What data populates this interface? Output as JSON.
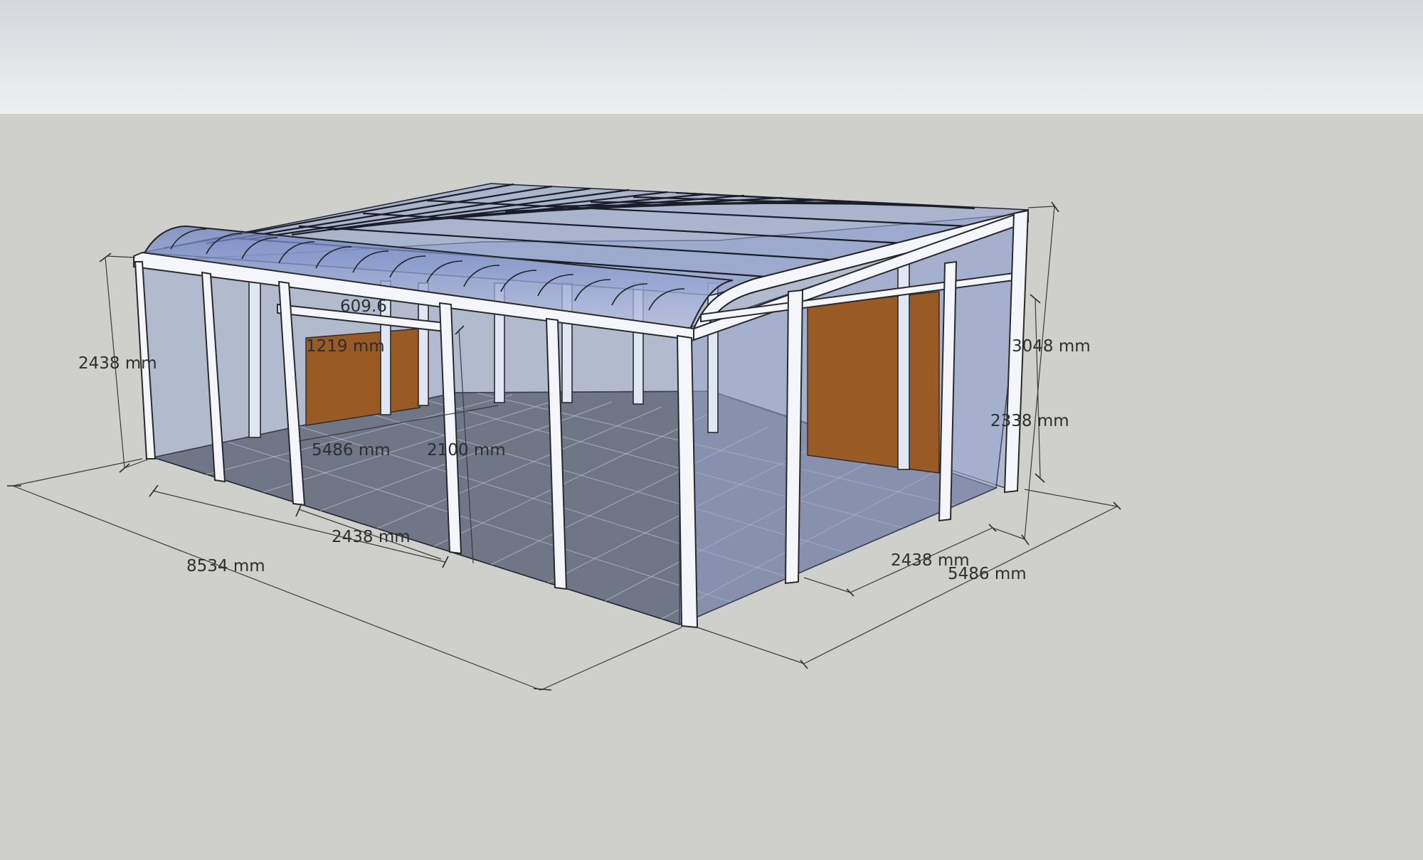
{
  "model": {
    "colors": {
      "sky_top": "#d4d8dd",
      "sky_bottom": "#eef0f1",
      "ground": "#cfd0cb",
      "glass": "#8a9ccf",
      "frame": "#f4f6fb",
      "wood_panel": "#9a5a24",
      "floor": "#6f7786"
    }
  },
  "dimensions": {
    "height_left": "2438 mm",
    "width_front": "8534 mm",
    "bay_front": "2438 mm",
    "inner_depth": "5486 mm",
    "door_height": "2100 mm",
    "transom_height": "1219 mm",
    "transom_width": "609.6",
    "height_total": "3048 mm",
    "height_side": "2338 mm",
    "bay_side": "2438 mm",
    "depth_side": "5486 mm"
  }
}
